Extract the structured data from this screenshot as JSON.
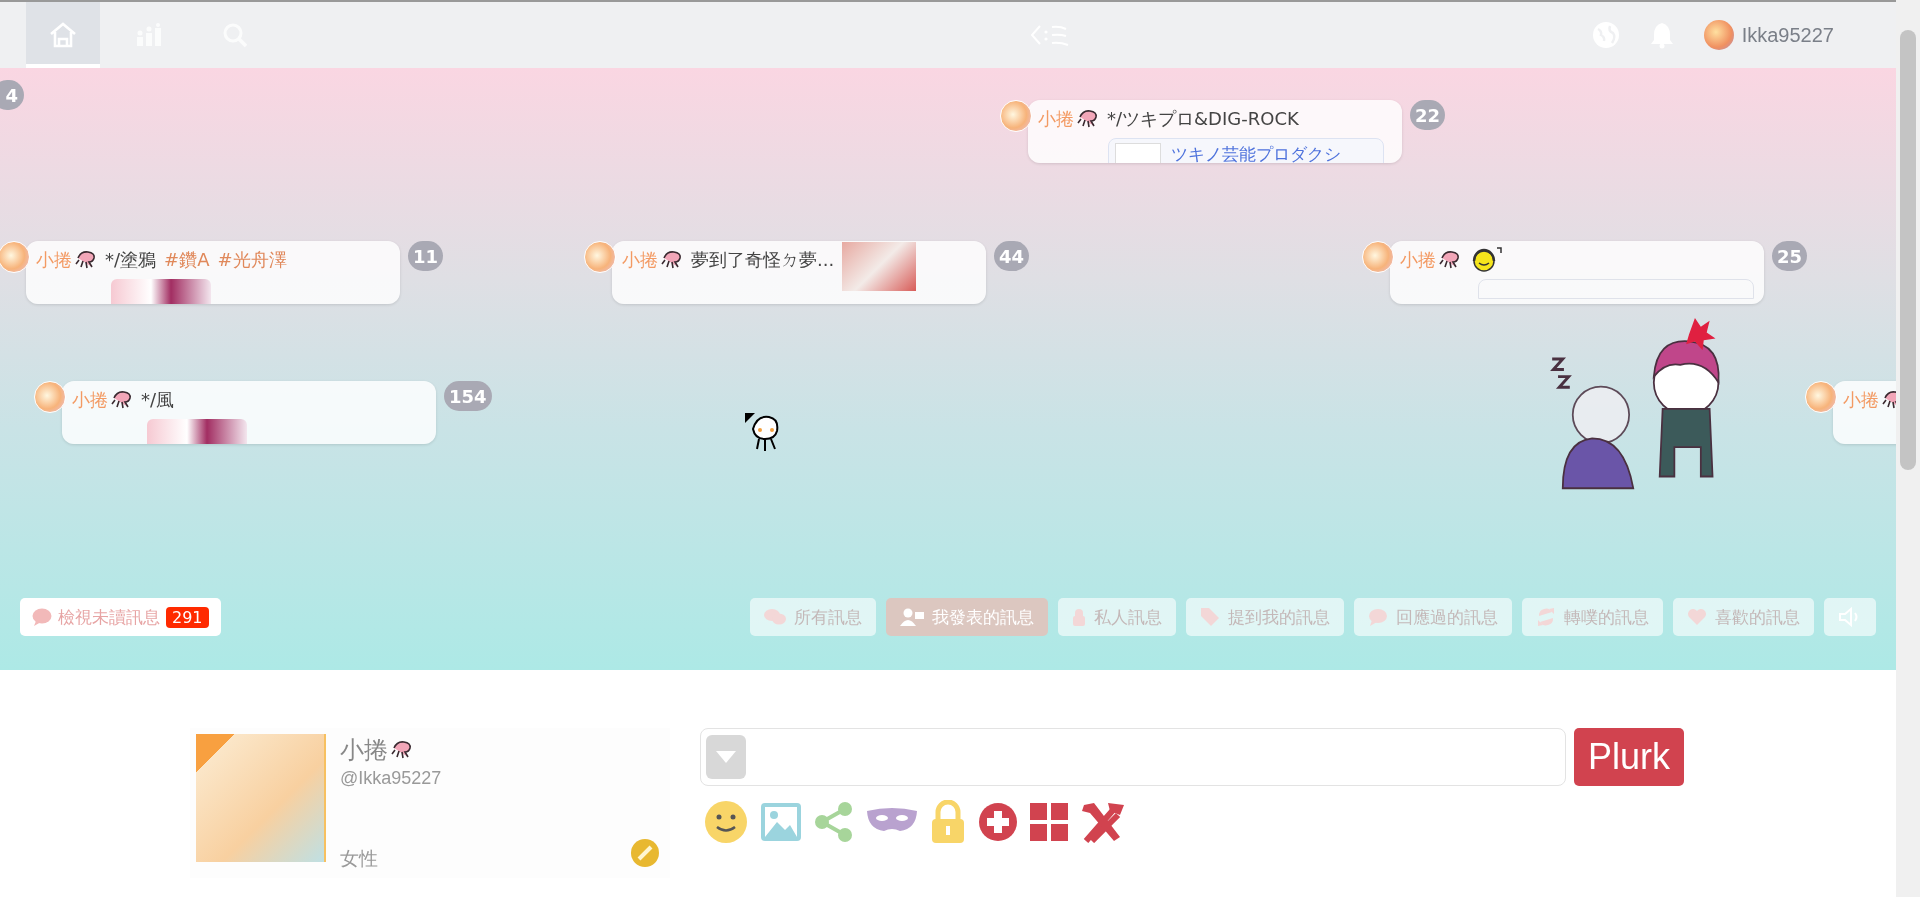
{
  "top_bar": {
    "nav": [
      {
        "kind": "home",
        "selected": true
      },
      {
        "kind": "stats",
        "selected": false
      },
      {
        "kind": "search",
        "selected": false
      }
    ],
    "username": "Ikka95227"
  },
  "timeline": {
    "edge_counts": [
      "4"
    ],
    "plurks": [
      {
        "author": "小捲",
        "segments": [
          {
            "kind": "text",
            "text": "*/ツキプロ&DIG-ROCK"
          }
        ],
        "preview": {
          "kind": "link",
          "text": "ツキノ芸能プロダクシ"
        },
        "count": "22"
      },
      {
        "author": "小捲",
        "segments": [
          {
            "kind": "text",
            "text": "*/塗鴉"
          },
          {
            "kind": "tag",
            "text": "#鑽A"
          },
          {
            "kind": "tag",
            "text": "#光舟澤"
          }
        ],
        "preview": {
          "kind": "image"
        },
        "count": "11"
      },
      {
        "author": "小捲",
        "segments": [
          {
            "kind": "text",
            "text": "夢到了奇怪ㄉ夢..."
          },
          {
            "kind": "thumb"
          }
        ],
        "count": "44"
      },
      {
        "author": "小捲",
        "segments": [
          {
            "kind": "emoticon"
          }
        ],
        "preview": {
          "kind": "blank"
        },
        "count": "25"
      },
      {
        "author": "小捲",
        "segments": [
          {
            "kind": "text",
            "text": "*/風"
          }
        ],
        "preview": {
          "kind": "image"
        },
        "count": "154"
      },
      {
        "author": "小捲"
      }
    ]
  },
  "filters": {
    "unread": {
      "label": "檢視未讀訊息",
      "count": "291"
    },
    "items": [
      {
        "kind": "all",
        "label": "所有訊息",
        "selected": false
      },
      {
        "kind": "mine",
        "label": "我發表的訊息",
        "selected": true
      },
      {
        "kind": "private",
        "label": "私人訊息",
        "selected": false
      },
      {
        "kind": "mentions",
        "label": "提到我的訊息",
        "selected": false
      },
      {
        "kind": "responded",
        "label": "回應過的訊息",
        "selected": false
      },
      {
        "kind": "replurked",
        "label": "轉噗的訊息",
        "selected": false
      },
      {
        "kind": "liked",
        "label": "喜歡的訊息",
        "selected": false
      },
      {
        "kind": "sound",
        "selected": false
      }
    ]
  },
  "profile": {
    "display_name": "小捲",
    "handle": "@Ikka95227",
    "gender": "女性"
  },
  "composer": {
    "button": "Plurk"
  }
}
